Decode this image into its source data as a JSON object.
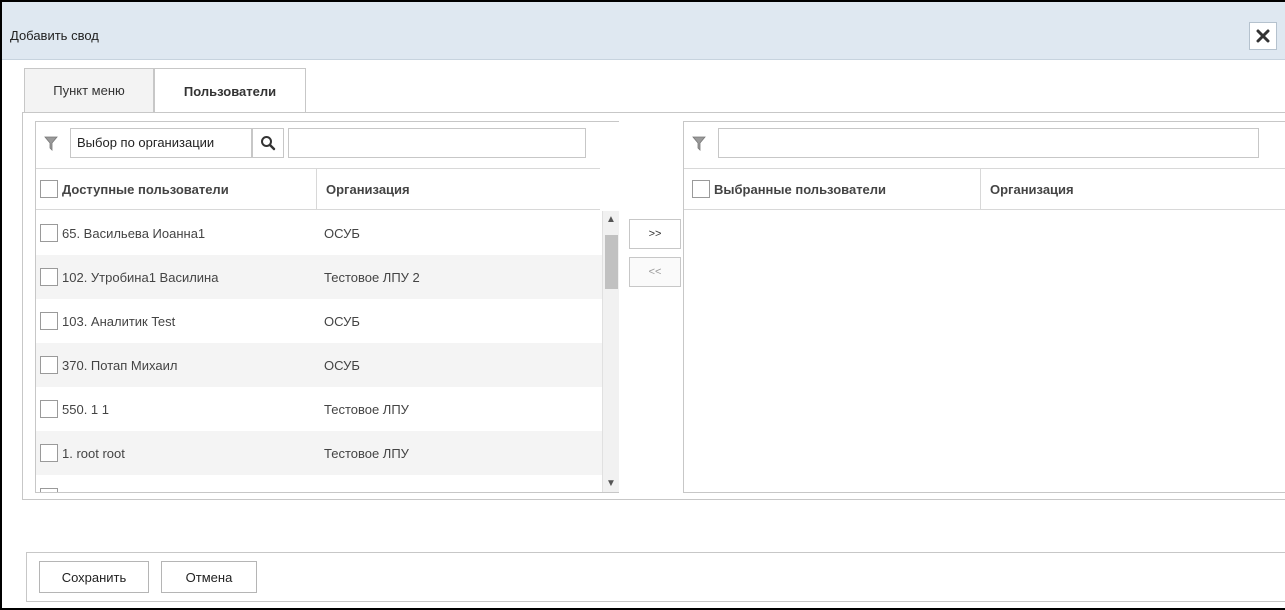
{
  "dialog": {
    "title": "Добавить свод"
  },
  "tabs": [
    {
      "label": "Пункт меню",
      "active": false
    },
    {
      "label": "Пользователи",
      "active": true
    }
  ],
  "left": {
    "filter_select": "Выбор по организации",
    "search_value": "",
    "columns": {
      "name": "Доступные пользователи",
      "org": "Организация"
    },
    "rows": [
      {
        "name": "65. Васильева Иоанна1",
        "org": "ОСУБ"
      },
      {
        "name": "102. Утробина1 Василина",
        "org": "Тестовое ЛПУ 2"
      },
      {
        "name": "103. Аналитик Test",
        "org": "ОСУБ"
      },
      {
        "name": "370. Потап Михаил",
        "org": "ОСУБ"
      },
      {
        "name": "550. 1 1",
        "org": "Тестовое ЛПУ"
      },
      {
        "name": "1. root root",
        "org": "Тестовое ЛПУ"
      },
      {
        "name": "",
        "org": ""
      }
    ]
  },
  "transfer": {
    "add_label": ">>",
    "remove_label": "<<"
  },
  "right": {
    "search_value": "",
    "columns": {
      "name": "Выбранные пользователи",
      "org": "Организация"
    }
  },
  "footer": {
    "save_label": "Сохранить",
    "cancel_label": "Отмена"
  },
  "icons": {
    "filter": "filter-icon",
    "search": "search-icon",
    "close": "close-icon"
  }
}
